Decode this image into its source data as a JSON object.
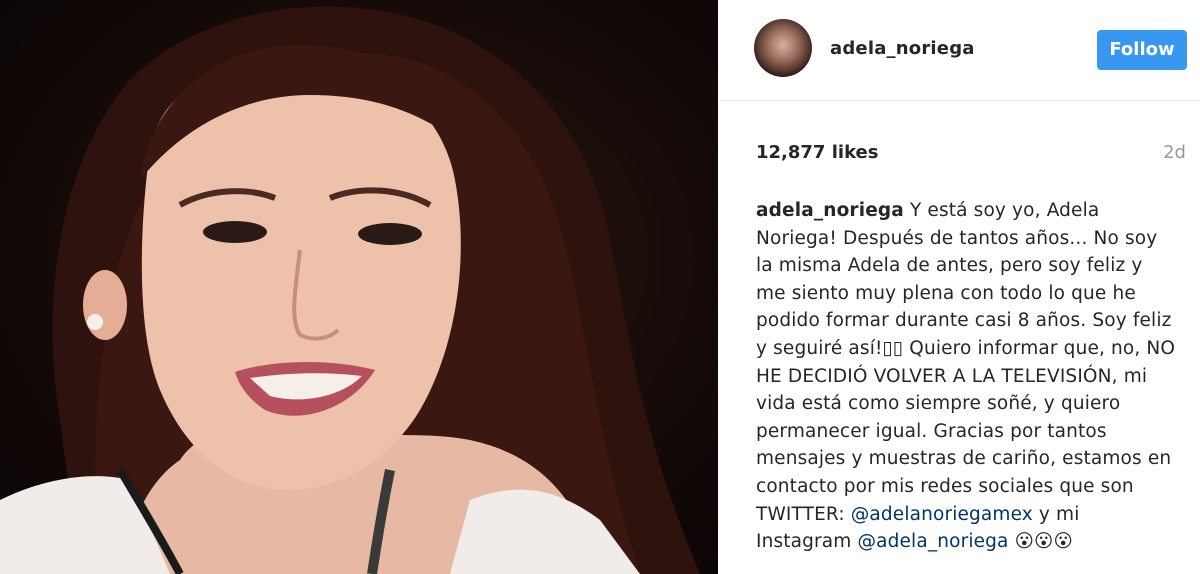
{
  "post": {
    "username": "adela_noriega",
    "follow_label": "Follow",
    "likes": "12,877 likes",
    "age": "2d",
    "caption": {
      "user": "adela_noriega",
      "text_1": " Y está soy yo, Adela Noriega! Después de tantos años... No soy la misma Adela de antes, pero soy feliz y me siento muy plena con todo lo que he podido formar durante casi 8 años. Soy feliz y seguiré así!▯▯ Quiero informar que, no, NO HE DECIDIÓ VOLVER A LA TELEVISIÓN, mi vida está como siempre soñé, y quiero permanecer igual. Gracias por tantos mensajes y muestras de cariño, estamos en contacto por mis redes sociales que son TWITTER: ",
      "mention_twitter": "@adelanoriegamex",
      "text_2": " y mi Instagram ",
      "mention_instagram": "@adela_noriega",
      "emoji": " 😮😮😮"
    }
  },
  "colors": {
    "follow_button": "#3897f0",
    "mention": "#003569",
    "muted": "#999999",
    "text": "#262626"
  }
}
